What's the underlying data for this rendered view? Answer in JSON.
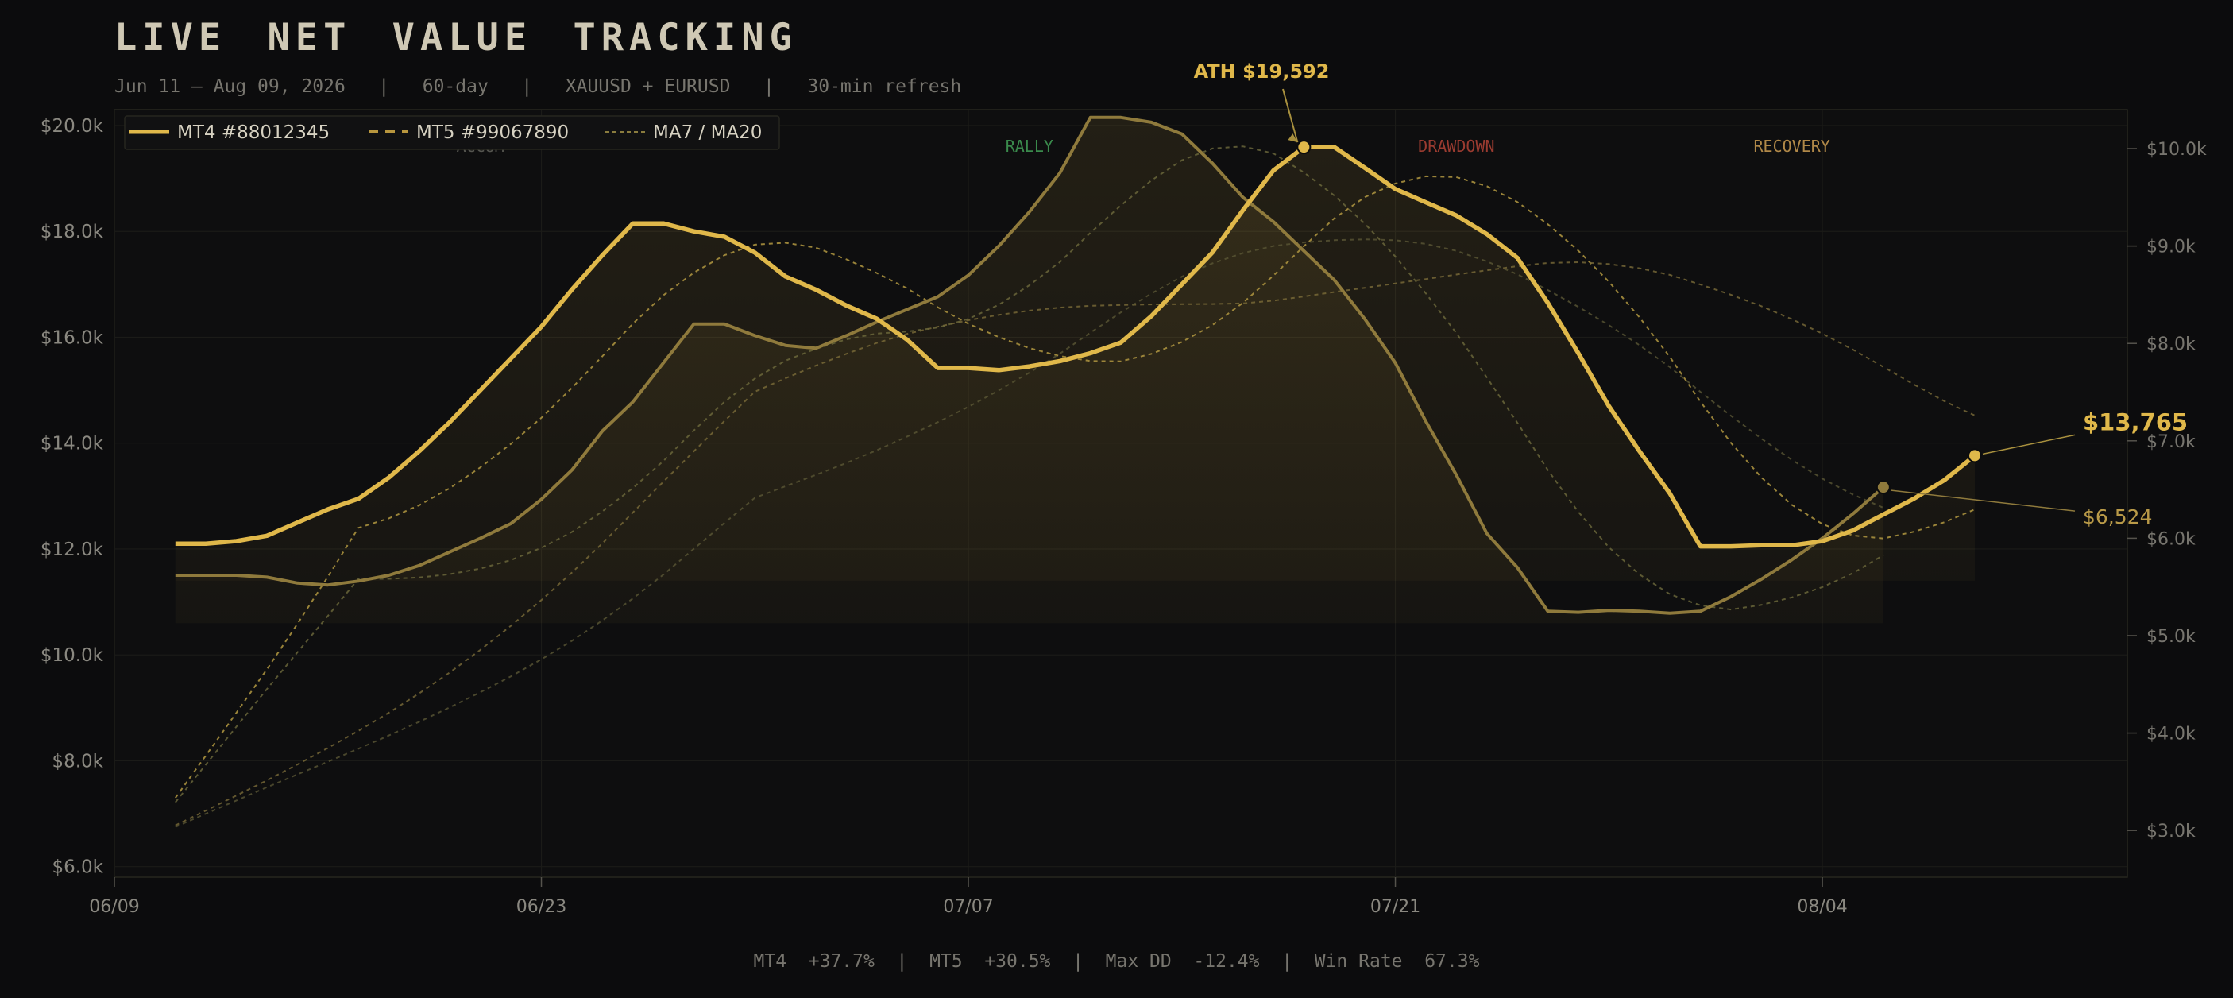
{
  "header": {
    "title": "LIVE  NET  VALUE  TRACKING",
    "subtitle": "Jun 11 — Aug 09, 2026   |   60-day   |   XAUUSD + EURUSD   |   30-min refresh"
  },
  "footer": {
    "stats": "MT4  +37.7%  |  MT5  +30.5%  |  Max DD  -12.4%  |  Win Rate  67.3%"
  },
  "colors": {
    "background": "#0c0c0d",
    "mt4": "#e0b84a",
    "mt5": "#8f7a3c",
    "ma": "#6e6a3c",
    "rally": "#3a8a4c",
    "drawdown": "#9a3b30",
    "recovery": "#b08848",
    "accum": "#55554f"
  },
  "chart_data": {
    "type": "line",
    "x_axis": {
      "ticks": [
        "06/09",
        "06/23",
        "07/07",
        "07/21",
        "08/04"
      ],
      "range": [
        "2026-06-09",
        "2026-08-14"
      ]
    },
    "y_left": {
      "ticks": [
        "$6.0k",
        "$8.0k",
        "$10.0k",
        "$12.0k",
        "$14.0k",
        "$16.0k",
        "$18.0k",
        "$20.0k"
      ],
      "range": [
        5800,
        20300
      ]
    },
    "y_right": {
      "ticks": [
        "$3.0k",
        "$4.0k",
        "$5.0k",
        "$6.0k",
        "$7.0k",
        "$8.0k",
        "$9.0k",
        "$10.0k"
      ],
      "range": [
        2520,
        10400
      ]
    },
    "grid": true,
    "legend": {
      "placement": "top-left",
      "items": [
        {
          "label": "MT4   #88012345",
          "style": "solid"
        },
        {
          "label": "MT5   #99067890",
          "style": "dashed"
        },
        {
          "label": "MA7 / MA20",
          "style": "dotted"
        }
      ]
    },
    "phases": [
      {
        "label": "ACCUM",
        "date": "2026-06-21"
      },
      {
        "label": "RALLY",
        "date": "2026-07-09"
      },
      {
        "label": "DRAWDOWN",
        "date": "2026-07-23"
      },
      {
        "label": "RECOVERY",
        "date": "2026-08-03"
      }
    ],
    "annotations": {
      "ath_label": "ATH  $19,592",
      "ath": {
        "date": "2026-07-18",
        "value": 19592
      },
      "mt4_last_label": "$13,765",
      "mt5_last_label": "$6,524"
    },
    "series": [
      {
        "name": "MT4   #88012345",
        "axis": "left",
        "points": [
          [
            "2026-06-11",
            12100
          ],
          [
            "2026-06-12",
            12100
          ],
          [
            "2026-06-13",
            12150
          ],
          [
            "2026-06-14",
            12250
          ],
          [
            "2026-06-15",
            12500
          ],
          [
            "2026-06-16",
            12750
          ],
          [
            "2026-06-17",
            12950
          ],
          [
            "2026-06-18",
            13350
          ],
          [
            "2026-06-19",
            13850
          ],
          [
            "2026-06-20",
            14400
          ],
          [
            "2026-06-21",
            15000
          ],
          [
            "2026-06-22",
            15600
          ],
          [
            "2026-06-23",
            16200
          ],
          [
            "2026-06-24",
            16900
          ],
          [
            "2026-06-25",
            17550
          ],
          [
            "2026-06-26",
            18150
          ],
          [
            "2026-06-27",
            18150
          ],
          [
            "2026-06-28",
            18000
          ],
          [
            "2026-06-29",
            17900
          ],
          [
            "2026-06-30",
            17600
          ],
          [
            "2026-07-01",
            17150
          ],
          [
            "2026-07-02",
            16900
          ],
          [
            "2026-07-03",
            16600
          ],
          [
            "2026-07-04",
            16350
          ],
          [
            "2026-07-05",
            15950
          ],
          [
            "2026-07-06",
            15420
          ],
          [
            "2026-07-07",
            15420
          ],
          [
            "2026-07-08",
            15380
          ],
          [
            "2026-07-09",
            15450
          ],
          [
            "2026-07-10",
            15550
          ],
          [
            "2026-07-11",
            15700
          ],
          [
            "2026-07-12",
            15900
          ],
          [
            "2026-07-13",
            16400
          ],
          [
            "2026-07-14",
            17000
          ],
          [
            "2026-07-15",
            17600
          ],
          [
            "2026-07-16",
            18400
          ],
          [
            "2026-07-17",
            19150
          ],
          [
            "2026-07-18",
            19592
          ],
          [
            "2026-07-19",
            19592
          ],
          [
            "2026-07-20",
            19200
          ],
          [
            "2026-07-21",
            18800
          ],
          [
            "2026-07-22",
            18550
          ],
          [
            "2026-07-23",
            18300
          ],
          [
            "2026-07-24",
            17950
          ],
          [
            "2026-07-25",
            17500
          ],
          [
            "2026-07-26",
            16650
          ],
          [
            "2026-07-27",
            15700
          ],
          [
            "2026-07-28",
            14700
          ],
          [
            "2026-07-29",
            13850
          ],
          [
            "2026-07-30",
            13050
          ],
          [
            "2026-07-31",
            12050
          ],
          [
            "2026-08-01",
            12050
          ],
          [
            "2026-08-02",
            12070
          ],
          [
            "2026-08-03",
            12070
          ],
          [
            "2026-08-04",
            12150
          ],
          [
            "2026-08-05",
            12350
          ],
          [
            "2026-08-06",
            12650
          ],
          [
            "2026-08-07",
            12950
          ],
          [
            "2026-08-08",
            13300
          ],
          [
            "2026-08-09",
            13765
          ]
        ]
      },
      {
        "name": "MT5   #99067890",
        "axis": "right",
        "points": [
          [
            "2026-06-11",
            5620
          ],
          [
            "2026-06-12",
            5620
          ],
          [
            "2026-06-13",
            5620
          ],
          [
            "2026-06-14",
            5600
          ],
          [
            "2026-06-15",
            5540
          ],
          [
            "2026-06-16",
            5520
          ],
          [
            "2026-06-17",
            5560
          ],
          [
            "2026-06-18",
            5620
          ],
          [
            "2026-06-19",
            5720
          ],
          [
            "2026-06-20",
            5860
          ],
          [
            "2026-06-21",
            6000
          ],
          [
            "2026-06-22",
            6150
          ],
          [
            "2026-06-23",
            6400
          ],
          [
            "2026-06-24",
            6700
          ],
          [
            "2026-06-25",
            7100
          ],
          [
            "2026-06-26",
            7400
          ],
          [
            "2026-06-27",
            7800
          ],
          [
            "2026-06-28",
            8200
          ],
          [
            "2026-06-29",
            8200
          ],
          [
            "2026-06-30",
            8080
          ],
          [
            "2026-07-01",
            7980
          ],
          [
            "2026-07-02",
            7950
          ],
          [
            "2026-07-03",
            8080
          ],
          [
            "2026-07-04",
            8220
          ],
          [
            "2026-07-05",
            8350
          ],
          [
            "2026-07-06",
            8480
          ],
          [
            "2026-07-07",
            8700
          ],
          [
            "2026-07-08",
            9000
          ],
          [
            "2026-07-09",
            9350
          ],
          [
            "2026-07-10",
            9750
          ],
          [
            "2026-07-11",
            10320
          ],
          [
            "2026-07-12",
            10320
          ],
          [
            "2026-07-13",
            10270
          ],
          [
            "2026-07-14",
            10150
          ],
          [
            "2026-07-15",
            9850
          ],
          [
            "2026-07-16",
            9500
          ],
          [
            "2026-07-17",
            9250
          ],
          [
            "2026-07-18",
            8950
          ],
          [
            "2026-07-19",
            8650
          ],
          [
            "2026-07-20",
            8250
          ],
          [
            "2026-07-21",
            7800
          ],
          [
            "2026-07-22",
            7200
          ],
          [
            "2026-07-23",
            6650
          ],
          [
            "2026-07-24",
            6050
          ],
          [
            "2026-07-25",
            5700
          ],
          [
            "2026-07-26",
            5250
          ],
          [
            "2026-07-27",
            5240
          ],
          [
            "2026-07-28",
            5260
          ],
          [
            "2026-07-29",
            5250
          ],
          [
            "2026-07-30",
            5230
          ],
          [
            "2026-07-31",
            5250
          ],
          [
            "2026-08-01",
            5400
          ],
          [
            "2026-08-02",
            5580
          ],
          [
            "2026-08-03",
            5780
          ],
          [
            "2026-08-04",
            6000
          ],
          [
            "2026-08-05",
            6250
          ],
          [
            "2026-08-06",
            6524
          ]
        ]
      }
    ]
  }
}
